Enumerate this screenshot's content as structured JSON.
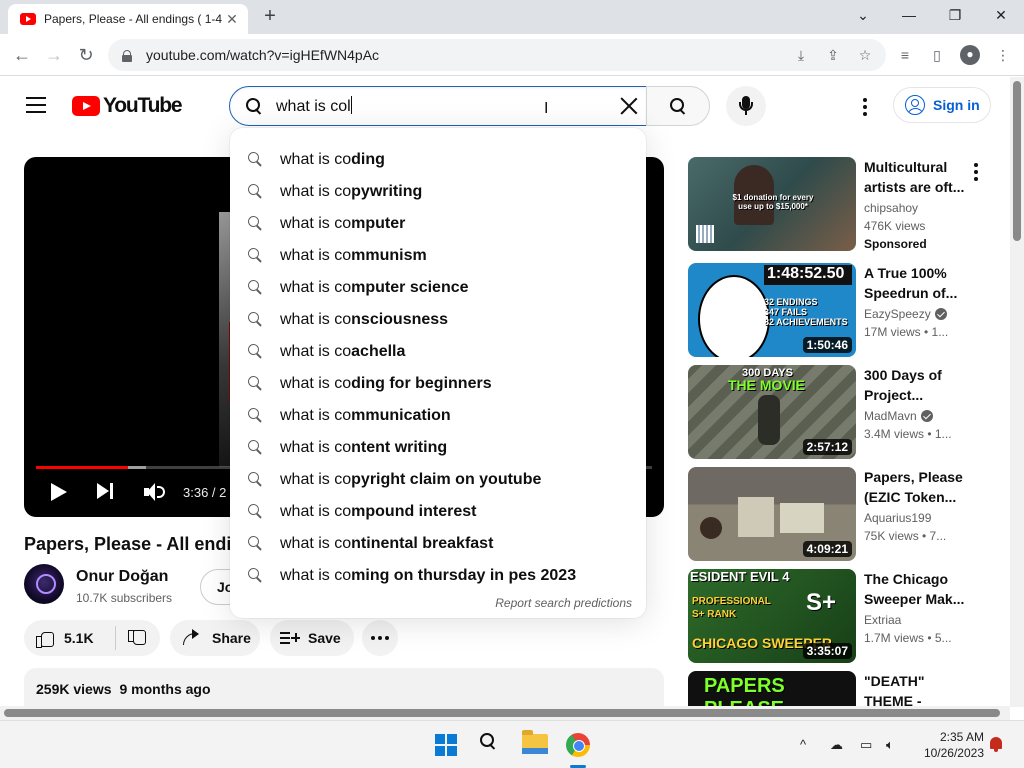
{
  "browser": {
    "tab_title": "Papers, Please - All endings ( 1-4",
    "url": "youtube.com/watch?v=igHEfWN4pAc",
    "new_tab_symbol": "+",
    "tab_close_symbol": "✕",
    "window_minimize": "—",
    "window_restore": "❐",
    "window_close": "✕",
    "window_dropdown": "⌄"
  },
  "youtube": {
    "logo_text": "YouTube",
    "search_query": "what is col",
    "sign_in_label": "Sign in",
    "brand_color": "#ff0000",
    "accent_color": "#065fd4"
  },
  "suggestions": {
    "prefix": "what is co",
    "items": [
      {
        "prefix": "what is co",
        "rest": "ding"
      },
      {
        "prefix": "what is co",
        "rest": "pywriting"
      },
      {
        "prefix": "what is co",
        "rest": "mputer"
      },
      {
        "prefix": "what is co",
        "rest": "mmunism"
      },
      {
        "prefix": "what is co",
        "rest": "mputer science"
      },
      {
        "prefix": "what is co",
        "rest": "nsciousness"
      },
      {
        "prefix": "what is co",
        "rest": "achella"
      },
      {
        "prefix": "what is co",
        "rest": "ding for beginners"
      },
      {
        "prefix": "what is co",
        "rest": "mmunication"
      },
      {
        "prefix": "what is co",
        "rest": "ntent writing"
      },
      {
        "prefix": "what is co",
        "rest": "pyright claim on youtube"
      },
      {
        "prefix": "what is co",
        "rest": "mpound interest"
      },
      {
        "prefix": "what is co",
        "rest": "ntinental breakfast"
      },
      {
        "prefix": "what is co",
        "rest": "ming on thursday in pes 2023"
      }
    ],
    "report_label": "Report search predictions"
  },
  "player": {
    "time_display": "3:36 / 2",
    "progress_fraction": 0.15
  },
  "video": {
    "title": "Papers, Please - All endin",
    "channel_name": "Onur Doğan",
    "channel_subscribers": "10.7K subscribers",
    "join_label": "Jo",
    "like_count": "5.1K",
    "share_label": "Share",
    "save_label": "Save",
    "views": "259K views",
    "uploaded": "9 months ago"
  },
  "recommendations": [
    {
      "title_line1": "Multicultural",
      "title_line2": "artists are oft...",
      "channel": "chipsahoy",
      "meta": "476K views",
      "badge": "Sponsored",
      "duration": "",
      "thumb_text": "$1 donation for every use up to $15,000*",
      "verified": false
    },
    {
      "title_line1": "A True 100%",
      "title_line2": "Speedrun of...",
      "channel": "EazySpeezy",
      "meta": "17M views  •  1...",
      "badge": "",
      "duration": "1:50:46",
      "thumb_text": "1:48:52.50",
      "thumb_text2": "32 ENDINGS\n347 FAILS\n82 ACHIEVEMENTS",
      "verified": true
    },
    {
      "title_line1": "300 Days of",
      "title_line2": "Project...",
      "channel": "MadMavn",
      "meta": "3.4M views  •  1...",
      "badge": "",
      "duration": "2:57:12",
      "thumb_text": "300 DAYS",
      "thumb_text2": "THE MOVIE",
      "verified": true
    },
    {
      "title_line1": "Papers, Please",
      "title_line2": "(EZIC Token...",
      "channel": "Aquarius199",
      "meta": "75K views  •  7...",
      "badge": "",
      "duration": "4:09:21",
      "verified": false
    },
    {
      "title_line1": "The Chicago",
      "title_line2": "Sweeper Mak...",
      "channel": "Extriaa",
      "meta": "1.7M views  •  5...",
      "badge": "",
      "duration": "3:35:07",
      "thumb_text": "ESIDENT EVIL 4",
      "thumb_text2": "PROFESSIONAL\nS+ RANK",
      "thumb_text3": "CHICAGO SWEEPER",
      "thumb_text4": "S+",
      "verified": false
    },
    {
      "title_line1": "\"DEATH\"",
      "title_line2": "THEME -",
      "channel": "",
      "meta": "",
      "badge": "",
      "duration": "",
      "thumb_text": "PAPERS PLEASE",
      "verified": false
    }
  ],
  "taskbar": {
    "time": "2:35 AM",
    "date": "10/26/2023",
    "tray_chevron": "^"
  }
}
